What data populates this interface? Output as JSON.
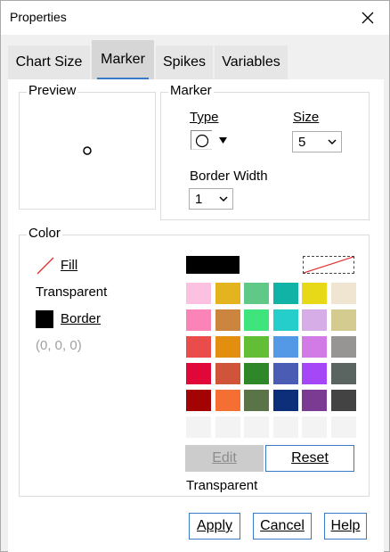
{
  "window": {
    "title": "Properties"
  },
  "tabs": [
    {
      "label": "Chart Size"
    },
    {
      "label": "Marker",
      "active": true
    },
    {
      "label": "Spikes"
    },
    {
      "label": "Variables"
    }
  ],
  "preview": {
    "title": "Preview"
  },
  "marker": {
    "title": "Marker",
    "type_label": "Type",
    "size_label": "Size",
    "size_value": "5",
    "border_width_label": "Border Width",
    "border_width_value": "1"
  },
  "color": {
    "title": "Color",
    "fill_label": "Fill",
    "fill_value": "Transparent",
    "border_label": "Border",
    "border_rgb": "(0, 0, 0)",
    "selected_swatch_color": "#000000",
    "palette": [
      [
        "#fcc1e0",
        "#e3b41e",
        "#60c987",
        "#10b3a6",
        "#e7d918",
        "#efe5d0"
      ],
      [
        "#fa84b8",
        "#cc853f",
        "#40e47d",
        "#25cecb",
        "#d6ade7",
        "#d4cb90"
      ],
      [
        "#ea4c4c",
        "#e38e0e",
        "#62be35",
        "#5399e5",
        "#d27ae5",
        "#979494"
      ],
      [
        "#e10839",
        "#d0543a",
        "#2e8829",
        "#4a5cb4",
        "#a547f7",
        "#5a6460"
      ],
      [
        "#a40304",
        "#f46f31",
        "#5b7447",
        "#0d2f7a",
        "#7b3b92",
        "#434343"
      ],
      [
        "#f3f3f3",
        "#f3f3f3",
        "#f3f3f3",
        "#f3f3f3",
        "#f3f3f3",
        "#f3f3f3"
      ]
    ],
    "edit_label": "Edit",
    "reset_label": "Reset",
    "selected_name": "Transparent"
  },
  "footer": {
    "apply_label": "Apply",
    "cancel_label": "Cancel",
    "help_label": "Help"
  },
  "icons": {
    "close": "close-icon",
    "marker_type": "circle-marker-icon",
    "dropdown": "chevron-down-icon",
    "transparent": "transparent-slash-icon"
  },
  "accent_color": "#3a78c8"
}
